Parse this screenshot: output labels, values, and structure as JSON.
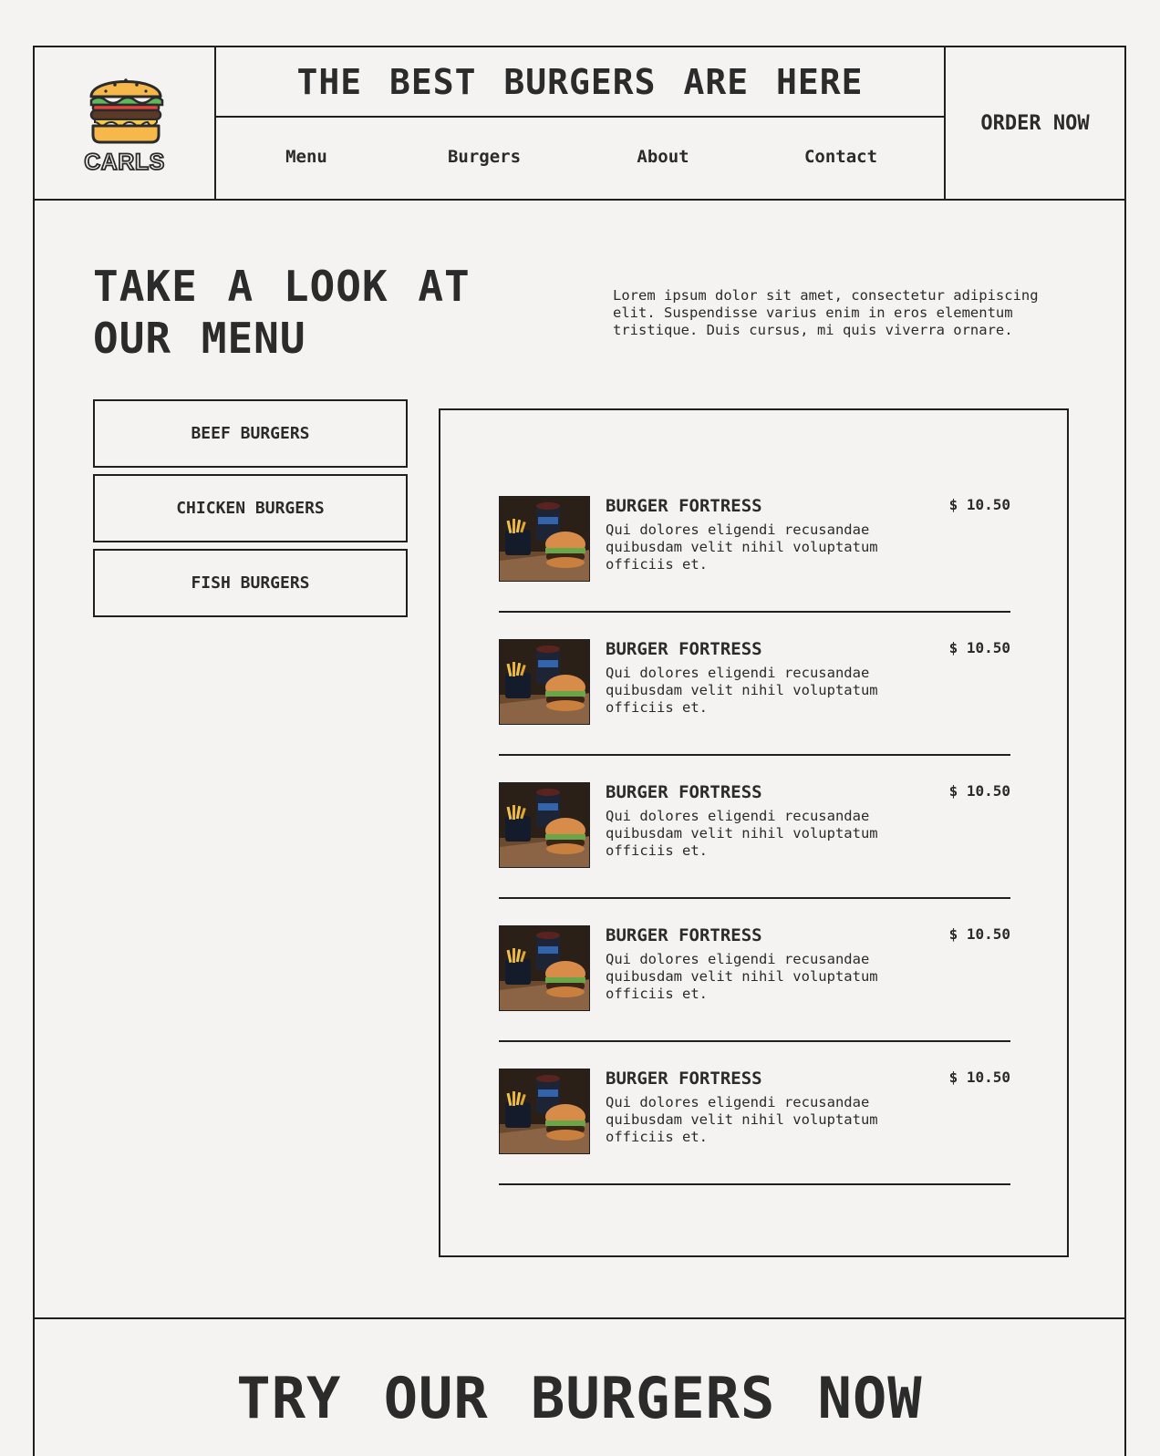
{
  "header": {
    "logo_text": "CARLS",
    "title": "THE BEST BURGERS ARE HERE",
    "nav": [
      {
        "label": "Menu"
      },
      {
        "label": "Burgers"
      },
      {
        "label": "About"
      },
      {
        "label": "Contact"
      }
    ],
    "order_label": "ORDER NOW"
  },
  "intro": {
    "title_line1": "TAKE A LOOK AT",
    "title_line2": "OUR MENU",
    "text": "Lorem ipsum dolor sit amet, consectetur adipiscing elit. Suspendisse varius enim in eros elementum tristique. Duis cursus, mi quis viverra ornare."
  },
  "categories": [
    {
      "label": "BEEF BURGERS"
    },
    {
      "label": "CHICKEN BURGERS"
    },
    {
      "label": "FISH BURGERS"
    }
  ],
  "menu_items": [
    {
      "name": "BURGER FORTRESS",
      "price": "$ 10.50",
      "description": "Qui dolores eligendi recusandae quibusdam velit nihil voluptatum officiis et."
    },
    {
      "name": "BURGER FORTRESS",
      "price": "$ 10.50",
      "description": "Qui dolores eligendi recusandae quibusdam velit nihil voluptatum officiis et."
    },
    {
      "name": "BURGER FORTRESS",
      "price": "$ 10.50",
      "description": "Qui dolores eligendi recusandae quibusdam velit nihil voluptatum officiis et."
    },
    {
      "name": "BURGER FORTRESS",
      "price": "$ 10.50",
      "description": "Qui dolores eligendi recusandae quibusdam velit nihil voluptatum officiis et."
    },
    {
      "name": "BURGER FORTRESS",
      "price": "$ 10.50",
      "description": "Qui dolores eligendi recusandae quibusdam velit nihil voluptatum officiis et."
    }
  ],
  "cta": {
    "title": "TRY OUR BURGERS NOW"
  },
  "colors": {
    "background": "#f4f3f1",
    "ink": "#2b2b2b",
    "bun": "#f7b84b",
    "lettuce": "#5fb85a",
    "tomato": "#e2453c",
    "patty": "#5b3a29"
  },
  "icons": {
    "logo": "burger-icon",
    "item_photo": "burger-fries-drink-photo"
  }
}
